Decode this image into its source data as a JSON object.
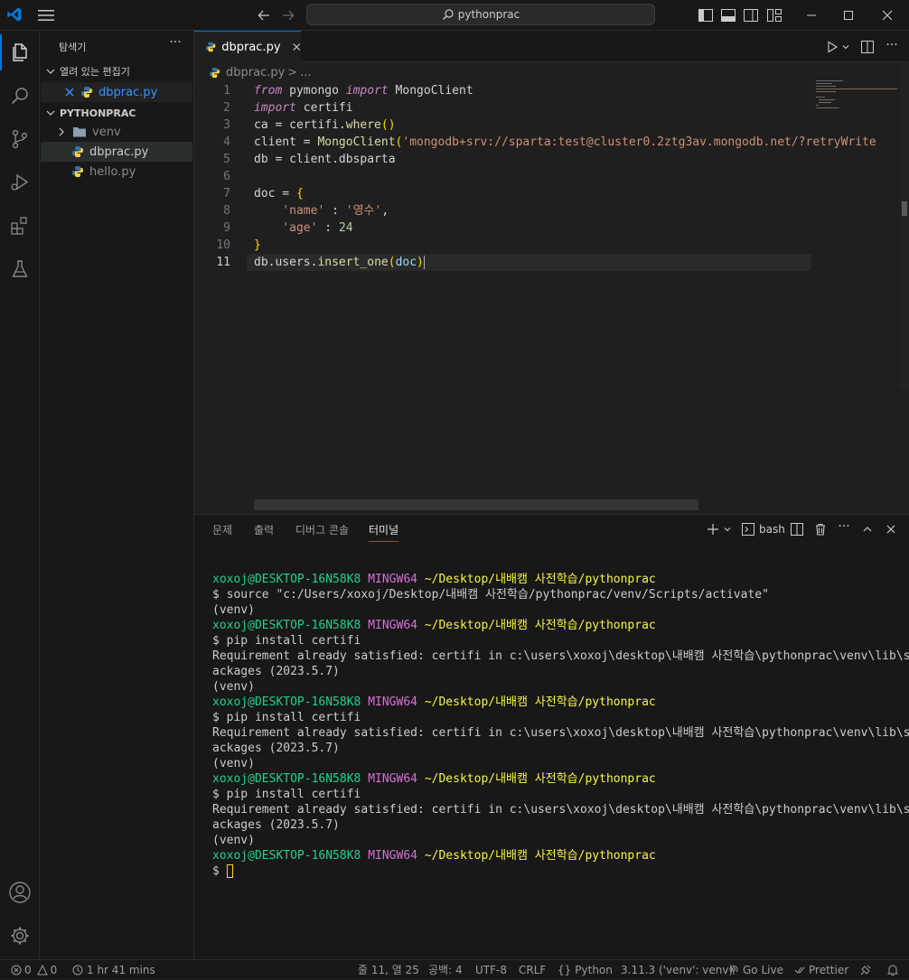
{
  "titlebar": {
    "search_text": "pythonprac"
  },
  "sidebar": {
    "title": "탐색기",
    "open_editors_label": "열려 있는 편집기",
    "open_editor_file": "dbprac.py",
    "folder_label": "PYTHONPRAC",
    "tree": [
      {
        "name": "venv",
        "type": "folder"
      },
      {
        "name": "dbprac.py",
        "type": "python"
      },
      {
        "name": "hello.py",
        "type": "python"
      }
    ]
  },
  "tabs": {
    "active_tab": "dbprac.py"
  },
  "breadcrumb": {
    "file": "dbprac.py",
    "sep": ">",
    "more": "..."
  },
  "editor": {
    "line_numbers": [
      "1",
      "2",
      "3",
      "4",
      "5",
      "6",
      "7",
      "8",
      "9",
      "10",
      "11"
    ],
    "active_line": 11
  },
  "panel": {
    "tabs": [
      "문제",
      "출력",
      "디버그 콘솔",
      "터미널"
    ],
    "active_tab": "터미널",
    "terminal_name": "bash"
  },
  "terminal": {
    "user_host": "xoxoj@DESKTOP-16N58K8",
    "shell": "MINGW64",
    "path": "~/Desktop/내배캠 사전학습/pythonprac",
    "lines": [
      "$ source \"c:/Users/xoxoj/Desktop/내배캠 사전학습/pythonprac/venv/Scripts/activate\"",
      "(venv)",
      "$ pip install certifi",
      "Requirement already satisfied: certifi in c:\\users\\xoxoj\\desktop\\내배캠 사전학습\\pythonprac\\venv\\lib\\site-p",
      "ackages (2023.5.7)",
      "(venv)",
      "$ pip install certifi",
      "Requirement already satisfied: certifi in c:\\users\\xoxoj\\desktop\\내배캠 사전학습\\pythonprac\\venv\\lib\\site-p",
      "ackages (2023.5.7)",
      "(venv)",
      "$ pip install certifi",
      "Requirement already satisfied: certifi in c:\\users\\xoxoj\\desktop\\내배캠 사전학습\\pythonprac\\venv\\lib\\site-p",
      "ackages (2023.5.7)",
      "(venv)",
      "$ "
    ]
  },
  "statusbar": {
    "errors": "0",
    "warnings": "0",
    "time": "1 hr 41 mins",
    "position": "줄 11, 열 25",
    "spaces": "공백: 4",
    "encoding": "UTF-8",
    "eol": "CRLF",
    "language": "Python",
    "interpreter": "3.11.3 ('venv': venv)",
    "golive": "Go Live",
    "prettier": "Prettier"
  },
  "colors": {
    "accent": "#0078d4",
    "python_blue": "#3572a5",
    "python_yellow": "#ffd43b"
  }
}
